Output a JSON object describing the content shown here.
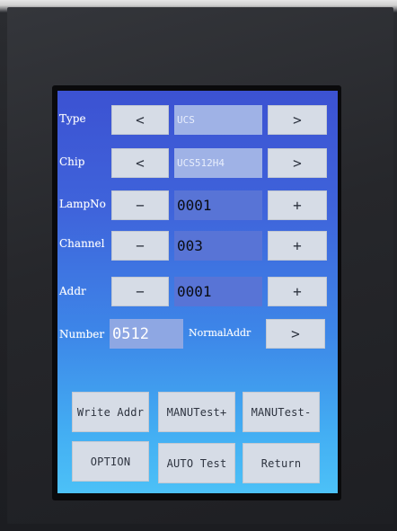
{
  "labels": {
    "type": "Type",
    "chip": "Chip",
    "lampno": "LampNo",
    "channel": "Channel",
    "addr": "Addr",
    "number": "Number",
    "normaladdr": "NormalAddr"
  },
  "values": {
    "type": "UCS",
    "chip": "UCS512H4",
    "lampno": "0001",
    "channel": "003",
    "addr": "0001",
    "number": "0512"
  },
  "glyphs": {
    "left": "<",
    "right": ">",
    "minus": "−",
    "plus": "+"
  },
  "buttons": {
    "write_addr": "Write Addr",
    "manu_test_plus": "MANUTest+",
    "manu_test_minus": "MANUTest-",
    "option": "OPTION",
    "auto_test": "AUTO Test",
    "return": "Return"
  },
  "colors": {
    "screen_top": "#3c52d2",
    "screen_bottom": "#4cc1f7",
    "button_bg": "#d6dce6"
  }
}
